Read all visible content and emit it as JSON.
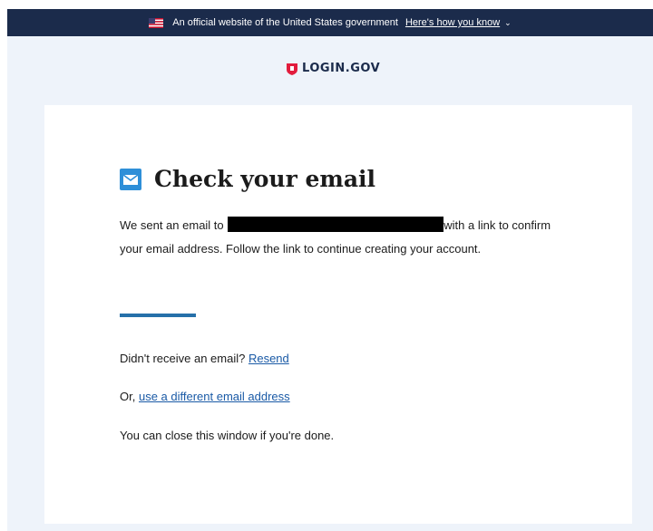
{
  "gov_banner": {
    "text": "An official website of the United States government",
    "link": "Here's how you know"
  },
  "logo": {
    "text": "LOGIN.GOV"
  },
  "card": {
    "title": "Check your email",
    "body_prefix": "We sent an email to ",
    "body_suffix": "with a link to confirm your email address. Follow the link to continue creating your account.",
    "resend_prompt": "Didn't receive an email?",
    "resend_link": "Resend",
    "different_prefix": "Or,",
    "different_link": "use a different email address",
    "close_note": "You can close this window if you're done."
  },
  "colors": {
    "banner_bg": "#1b2b4b",
    "page_bg": "#eef3fa",
    "accent": "#2670a9",
    "link": "#1a5aa6",
    "logo_red": "#e21c3d"
  },
  "icons": {
    "flag": "us-flag-icon",
    "chevron": "chevron-down-icon",
    "logo": "login-gov-shield-icon",
    "mail": "envelope-icon"
  }
}
